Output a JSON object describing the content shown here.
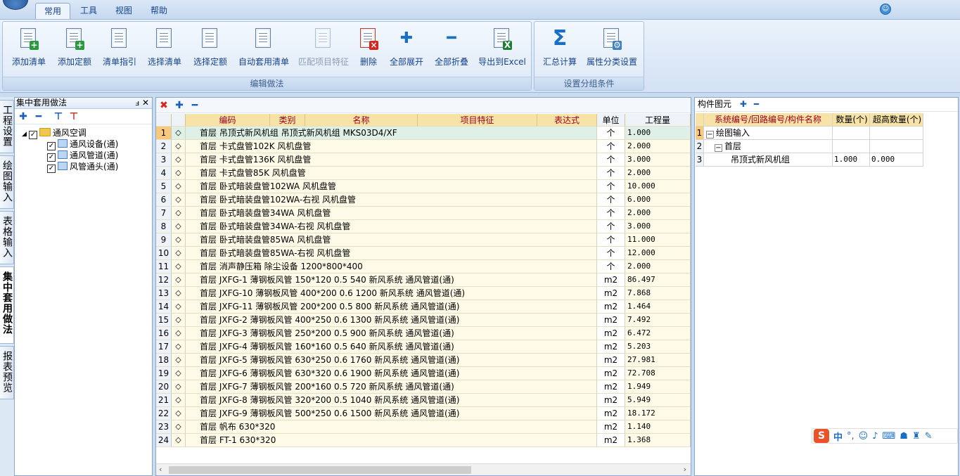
{
  "menu": {
    "tabs": [
      "常用",
      "工具",
      "视图",
      "帮助"
    ],
    "active": "常用"
  },
  "ribbon": {
    "edit_group": {
      "label": "编辑做法",
      "buttons": [
        {
          "label": "添加清单",
          "icon": "add-list-icon",
          "enabled": true
        },
        {
          "label": "添加定额",
          "icon": "add-quota-icon",
          "enabled": true
        },
        {
          "label": "清单指引",
          "icon": "list-guide-icon",
          "enabled": true
        },
        {
          "label": "选择清单",
          "icon": "select-list-icon",
          "enabled": true
        },
        {
          "label": "选择定额",
          "icon": "select-quota-icon",
          "enabled": true
        },
        {
          "label": "自动套用清单",
          "icon": "auto-apply-icon",
          "enabled": true
        },
        {
          "label": "匹配项目特征",
          "icon": "match-feature-icon",
          "enabled": false
        },
        {
          "label": "删除",
          "icon": "delete-icon",
          "enabled": true
        },
        {
          "label": "全部展开",
          "icon": "expand-all-icon",
          "enabled": true
        },
        {
          "label": "全部折叠",
          "icon": "collapse-all-icon",
          "enabled": true
        },
        {
          "label": "导出到Excel",
          "icon": "excel-export-icon",
          "enabled": true
        }
      ]
    },
    "group_group": {
      "label": "设置分组条件",
      "buttons": [
        {
          "label": "汇总计算",
          "icon": "sigma-icon"
        },
        {
          "label": "属性分类设置",
          "icon": "attribute-settings-icon"
        }
      ]
    }
  },
  "side_tabs": [
    "工程设置",
    "绘图输入",
    "表格输入",
    "集中套用做法",
    "报表预览"
  ],
  "side_tab_active": "集中套用做法",
  "left_panel": {
    "title": "集中套用做法",
    "tree": {
      "root": "通风空调",
      "children": [
        "通风设备(通)",
        "通风管道(通)",
        "风管通头(通)"
      ]
    }
  },
  "grid": {
    "headers": {
      "code": "编码",
      "type": "类别",
      "name": "名称",
      "feature": "项目特征",
      "expr": "表达式",
      "unit": "单位",
      "qty": "工程量"
    },
    "rows": [
      {
        "n": "1",
        "name": "首层 吊顶式新风机组 吊顶式新风机组 MKS03D4/XF",
        "unit": "个",
        "qty": "1.000"
      },
      {
        "n": "2",
        "name": "首层 卡式盘管102K 风机盘管",
        "unit": "个",
        "qty": "2.000"
      },
      {
        "n": "3",
        "name": "首层 卡式盘管136K 风机盘管",
        "unit": "个",
        "qty": "3.000"
      },
      {
        "n": "4",
        "name": "首层 卡式盘管85K 风机盘管",
        "unit": "个",
        "qty": "2.000"
      },
      {
        "n": "5",
        "name": "首层 卧式暗装盘管102WA 风机盘管",
        "unit": "个",
        "qty": "10.000"
      },
      {
        "n": "6",
        "name": "首层 卧式暗装盘管102WA-右视 风机盘管",
        "unit": "个",
        "qty": "6.000"
      },
      {
        "n": "7",
        "name": "首层 卧式暗装盘管34WA 风机盘管",
        "unit": "个",
        "qty": "2.000"
      },
      {
        "n": "8",
        "name": "首层 卧式暗装盘管34WA-右视 风机盘管",
        "unit": "个",
        "qty": "3.000"
      },
      {
        "n": "9",
        "name": "首层 卧式暗装盘管85WA 风机盘管",
        "unit": "个",
        "qty": "11.000"
      },
      {
        "n": "10",
        "name": "首层 卧式暗装盘管85WA-右视 风机盘管",
        "unit": "个",
        "qty": "12.000"
      },
      {
        "n": "11",
        "name": "首层 消声静压箱 除尘设备 1200*800*400",
        "unit": "个",
        "qty": "2.000"
      },
      {
        "n": "12",
        "name": "首层 JXFG-1 薄钢板风管 150*120 0.5 540 新风系统 通风管道(通)",
        "unit": "m2",
        "qty": "86.497"
      },
      {
        "n": "13",
        "name": "首层 JXFG-10 薄钢板风管 400*200 0.6 1200 新风系统 通风管道(通)",
        "unit": "m2",
        "qty": "7.868"
      },
      {
        "n": "14",
        "name": "首层 JXFG-11 薄钢板风管 200*200 0.5 800 新风系统 通风管道(通)",
        "unit": "m2",
        "qty": "1.464"
      },
      {
        "n": "15",
        "name": "首层 JXFG-2 薄钢板风管 400*250 0.6 1300 新风系统 通风管道(通)",
        "unit": "m2",
        "qty": "7.492"
      },
      {
        "n": "16",
        "name": "首层 JXFG-3 薄钢板风管 250*200 0.5 900 新风系统 通风管道(通)",
        "unit": "m2",
        "qty": "6.472"
      },
      {
        "n": "17",
        "name": "首层 JXFG-4 薄钢板风管 160*160 0.5 640 新风系统 通风管道(通)",
        "unit": "m2",
        "qty": "5.203"
      },
      {
        "n": "18",
        "name": "首层 JXFG-5 薄钢板风管 630*250 0.6 1760 新风系统 通风管道(通)",
        "unit": "m2",
        "qty": "27.981"
      },
      {
        "n": "19",
        "name": "首层 JXFG-6 薄钢板风管 630*320 0.6 1900 新风系统 通风管道(通)",
        "unit": "m2",
        "qty": "72.708"
      },
      {
        "n": "20",
        "name": "首层 JXFG-7 薄钢板风管 200*160 0.5 720 新风系统 通风管道(通)",
        "unit": "m2",
        "qty": "1.949"
      },
      {
        "n": "21",
        "name": "首层 JXFG-8 薄钢板风管 320*200 0.5 1040 新风系统 通风管道(通)",
        "unit": "m2",
        "qty": "5.949"
      },
      {
        "n": "22",
        "name": "首层 JXFG-9 薄钢板风管 500*250 0.6 1500 新风系统 通风管道(通)",
        "unit": "m2",
        "qty": "18.172"
      },
      {
        "n": "23",
        "name": "首层 帆布 630*320",
        "unit": "m2",
        "qty": "1.140"
      },
      {
        "n": "24",
        "name": "首层 FT-1 630*320",
        "unit": "m2",
        "qty": "1.368"
      }
    ]
  },
  "right_panel": {
    "title": "构件图元",
    "headers": {
      "name": "系统编号/回路编号/构件名称",
      "qty": "数量(个)",
      "qty2": "超高数量(个)"
    },
    "rows": [
      {
        "n": "1",
        "name": "绘图输入",
        "qty": "",
        "qty2": ""
      },
      {
        "n": "2",
        "name": "首层",
        "qty": "",
        "qty2": ""
      },
      {
        "n": "3",
        "name": "吊顶式新风机组",
        "qty": "1.000",
        "qty2": "0.000"
      }
    ]
  },
  "ime": {
    "logo": "S",
    "mode": "中"
  }
}
